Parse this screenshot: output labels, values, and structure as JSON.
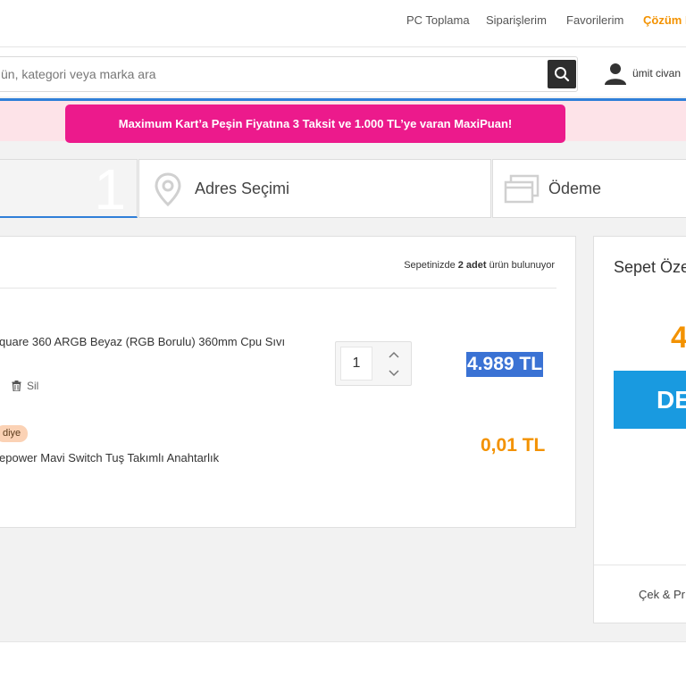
{
  "topnav": {
    "links": [
      "PC Toplama",
      "Siparişlerim",
      "Favorilerim",
      "Çözüm Merkezi"
    ]
  },
  "header": {
    "search_placeholder": "ün, kategori veya marka ara",
    "user_name": "ümit civan"
  },
  "promo": {
    "text": "Maximum Kart’a Peşin Fiyatına 3 Taksit ve 1.000 TL’ye varan MaxiPuan!"
  },
  "steps": [
    {
      "number": "1",
      "label": ""
    },
    {
      "label": "Adres Seçimi"
    },
    {
      "label": "Ödeme"
    }
  ],
  "cart": {
    "count_prefix": "Sepetinizde ",
    "count_bold": "2 adet",
    "count_suffix": " ürün bulunuyor",
    "items": [
      {
        "title": "quare 360 ARGB Beyaz (RGB Borulu) 360mm Cpu Sıvı",
        "delete_label": "Sil",
        "quantity": "1",
        "price": "4.989 TL"
      },
      {
        "badge": "diye",
        "title": "epower Mavi Switch Tuş Takımlı Anahtarlık",
        "price": "0,01 TL"
      }
    ]
  },
  "summary": {
    "title": "Sepet Özeti",
    "total": "4",
    "cta_label": "DE",
    "footer": "Çek & Pr"
  },
  "colors": {
    "accent_orange": "#f39200",
    "promo_pink": "#ec1a8c",
    "cta_blue": "#199ae0",
    "step_blue": "#2f7fd8"
  }
}
